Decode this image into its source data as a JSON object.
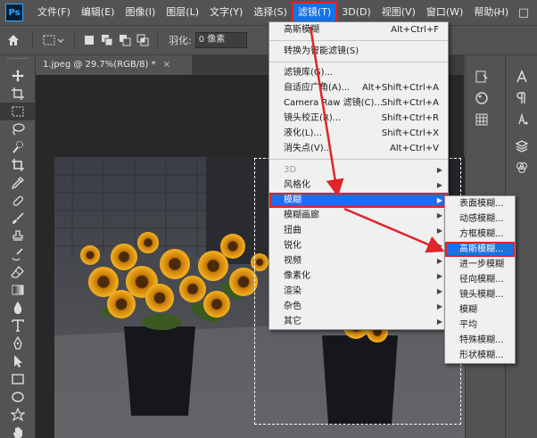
{
  "app": {
    "logo": "Ps"
  },
  "menubar": {
    "items": [
      "文件(F)",
      "编辑(E)",
      "图像(I)",
      "图层(L)",
      "文字(Y)",
      "选择(S)",
      "滤镜(T)",
      "3D(D)",
      "视图(V)",
      "窗口(W)",
      "帮助(H)"
    ],
    "active_index": 6
  },
  "window_controls": {
    "minimize": "–",
    "maximize": "□"
  },
  "options_bar": {
    "feather_label": "羽化:",
    "feather_value": "0 像素"
  },
  "document": {
    "tab_title": "1.jpeg @ 29.7%(RGB/8) *",
    "close_glyph": "×"
  },
  "filter_menu": {
    "items": [
      {
        "label": "高斯模糊",
        "shortcut": "Alt+Ctrl+F",
        "submenu": false,
        "disabled": false
      },
      {
        "divider": true
      },
      {
        "label": "转换为智能滤镜(S)",
        "shortcut": "",
        "submenu": false,
        "disabled": false
      },
      {
        "divider": true
      },
      {
        "label": "滤镜库(G)...",
        "shortcut": "",
        "submenu": false,
        "disabled": false
      },
      {
        "label": "自适应广角(A)...",
        "shortcut": "Alt+Shift+Ctrl+A",
        "submenu": false,
        "disabled": false
      },
      {
        "label": "Camera Raw 滤镜(C)...",
        "shortcut": "Shift+Ctrl+A",
        "submenu": false,
        "disabled": false
      },
      {
        "label": "镜头校正(R)...",
        "shortcut": "Shift+Ctrl+R",
        "submenu": false,
        "disabled": false
      },
      {
        "label": "液化(L)...",
        "shortcut": "Shift+Ctrl+X",
        "submenu": false,
        "disabled": false
      },
      {
        "label": "消失点(V)...",
        "shortcut": "Alt+Ctrl+V",
        "submenu": false,
        "disabled": false
      },
      {
        "divider": true
      },
      {
        "label": "3D",
        "shortcut": "",
        "submenu": true,
        "disabled": true
      },
      {
        "label": "风格化",
        "shortcut": "",
        "submenu": true,
        "disabled": false
      },
      {
        "label": "模糊",
        "shortcut": "",
        "submenu": true,
        "disabled": false,
        "highlighted": true
      },
      {
        "label": "模糊画廊",
        "shortcut": "",
        "submenu": true,
        "disabled": false
      },
      {
        "label": "扭曲",
        "shortcut": "",
        "submenu": true,
        "disabled": false
      },
      {
        "label": "锐化",
        "shortcut": "",
        "submenu": true,
        "disabled": false
      },
      {
        "label": "视频",
        "shortcut": "",
        "submenu": true,
        "disabled": false
      },
      {
        "label": "像素化",
        "shortcut": "",
        "submenu": true,
        "disabled": false
      },
      {
        "label": "渲染",
        "shortcut": "",
        "submenu": true,
        "disabled": false
      },
      {
        "label": "杂色",
        "shortcut": "",
        "submenu": true,
        "disabled": false
      },
      {
        "label": "其它",
        "shortcut": "",
        "submenu": true,
        "disabled": false
      }
    ]
  },
  "blur_submenu": {
    "items": [
      {
        "label": "表面模糊..."
      },
      {
        "label": "动感模糊..."
      },
      {
        "label": "方框模糊..."
      },
      {
        "label": "高斯模糊...",
        "highlighted": true
      },
      {
        "label": "进一步模糊"
      },
      {
        "label": "径向模糊..."
      },
      {
        "label": "镜头模糊..."
      },
      {
        "label": "模糊"
      },
      {
        "label": "平均"
      },
      {
        "label": "特殊模糊..."
      },
      {
        "label": "形状模糊..."
      }
    ]
  },
  "colors": {
    "accent_highlight": "#1473e6",
    "annotation_red": "#e0242a",
    "sunflower": "#f2a516"
  },
  "tools": [
    "move-icon",
    "artboard-icon",
    "marquee-icon",
    "lasso-icon",
    "quick-select-icon",
    "crop-icon",
    "frame-icon",
    "eyedropper-icon",
    "healing-icon",
    "brush-icon",
    "stamp-icon",
    "history-brush-icon",
    "eraser-icon",
    "gradient-icon",
    "blur-icon",
    "dodge-icon",
    "pen-icon",
    "type-icon",
    "path-select-icon",
    "rectangle-icon",
    "hand-icon",
    "zoom-icon"
  ]
}
